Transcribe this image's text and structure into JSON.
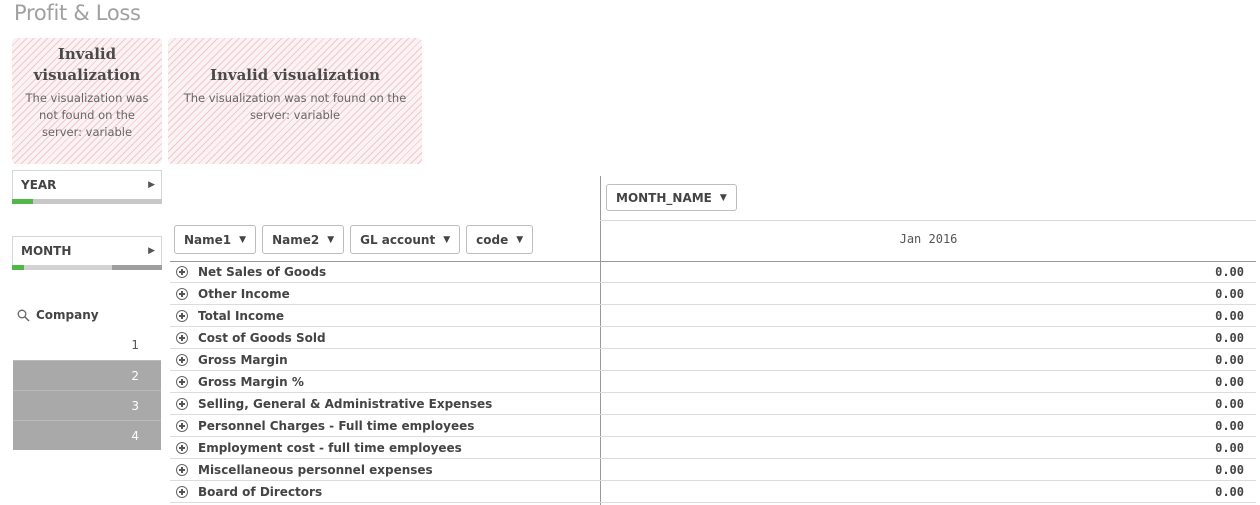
{
  "sheet": {
    "title": "Profit & Loss"
  },
  "invalid_viz": [
    {
      "title": "Invalid visualization",
      "message": "The visualization was not found on the server: variable"
    },
    {
      "title": "Invalid visualization",
      "message": "The visualization was not found on the server: variable"
    }
  ],
  "filters": {
    "year": {
      "label": "YEAR",
      "arrow_icon": "triangle-right-icon",
      "selected_fraction": 0.14
    },
    "month": {
      "label": "MONTH",
      "arrow_icon": "triangle-right-icon",
      "selected_fraction": 0.08
    }
  },
  "company_listbox": {
    "title": "Company",
    "search_icon": "search-icon",
    "items": [
      "1",
      "2",
      "3",
      "4"
    ]
  },
  "pivot": {
    "column_dimension": "MONTH_NAME",
    "row_dimensions": [
      "Name1",
      "Name2",
      "GL account",
      "code"
    ],
    "column_header": "Jan 2016",
    "rows": [
      {
        "label": "Net Sales of Goods",
        "value": "0.00"
      },
      {
        "label": "Other Income",
        "value": "0.00"
      },
      {
        "label": "Total Income",
        "value": "0.00"
      },
      {
        "label": "Cost of Goods Sold",
        "value": "0.00"
      },
      {
        "label": "Gross Margin",
        "value": "0.00"
      },
      {
        "label": "Gross Margin %",
        "value": "0.00"
      },
      {
        "label": "Selling, General & Administrative Expenses",
        "value": "0.00"
      },
      {
        "label": "Personnel Charges - Full time employees",
        "value": "0.00"
      },
      {
        "label": "Employment cost - full time employees",
        "value": "0.00"
      },
      {
        "label": "Miscellaneous personnel expenses",
        "value": "0.00"
      },
      {
        "label": "Board of Directors",
        "value": "0.00"
      }
    ]
  },
  "colors": {
    "selected_green": "#52b749",
    "excluded_gray": "#a9a9a9",
    "invalid_stripe": "#e296a0"
  }
}
